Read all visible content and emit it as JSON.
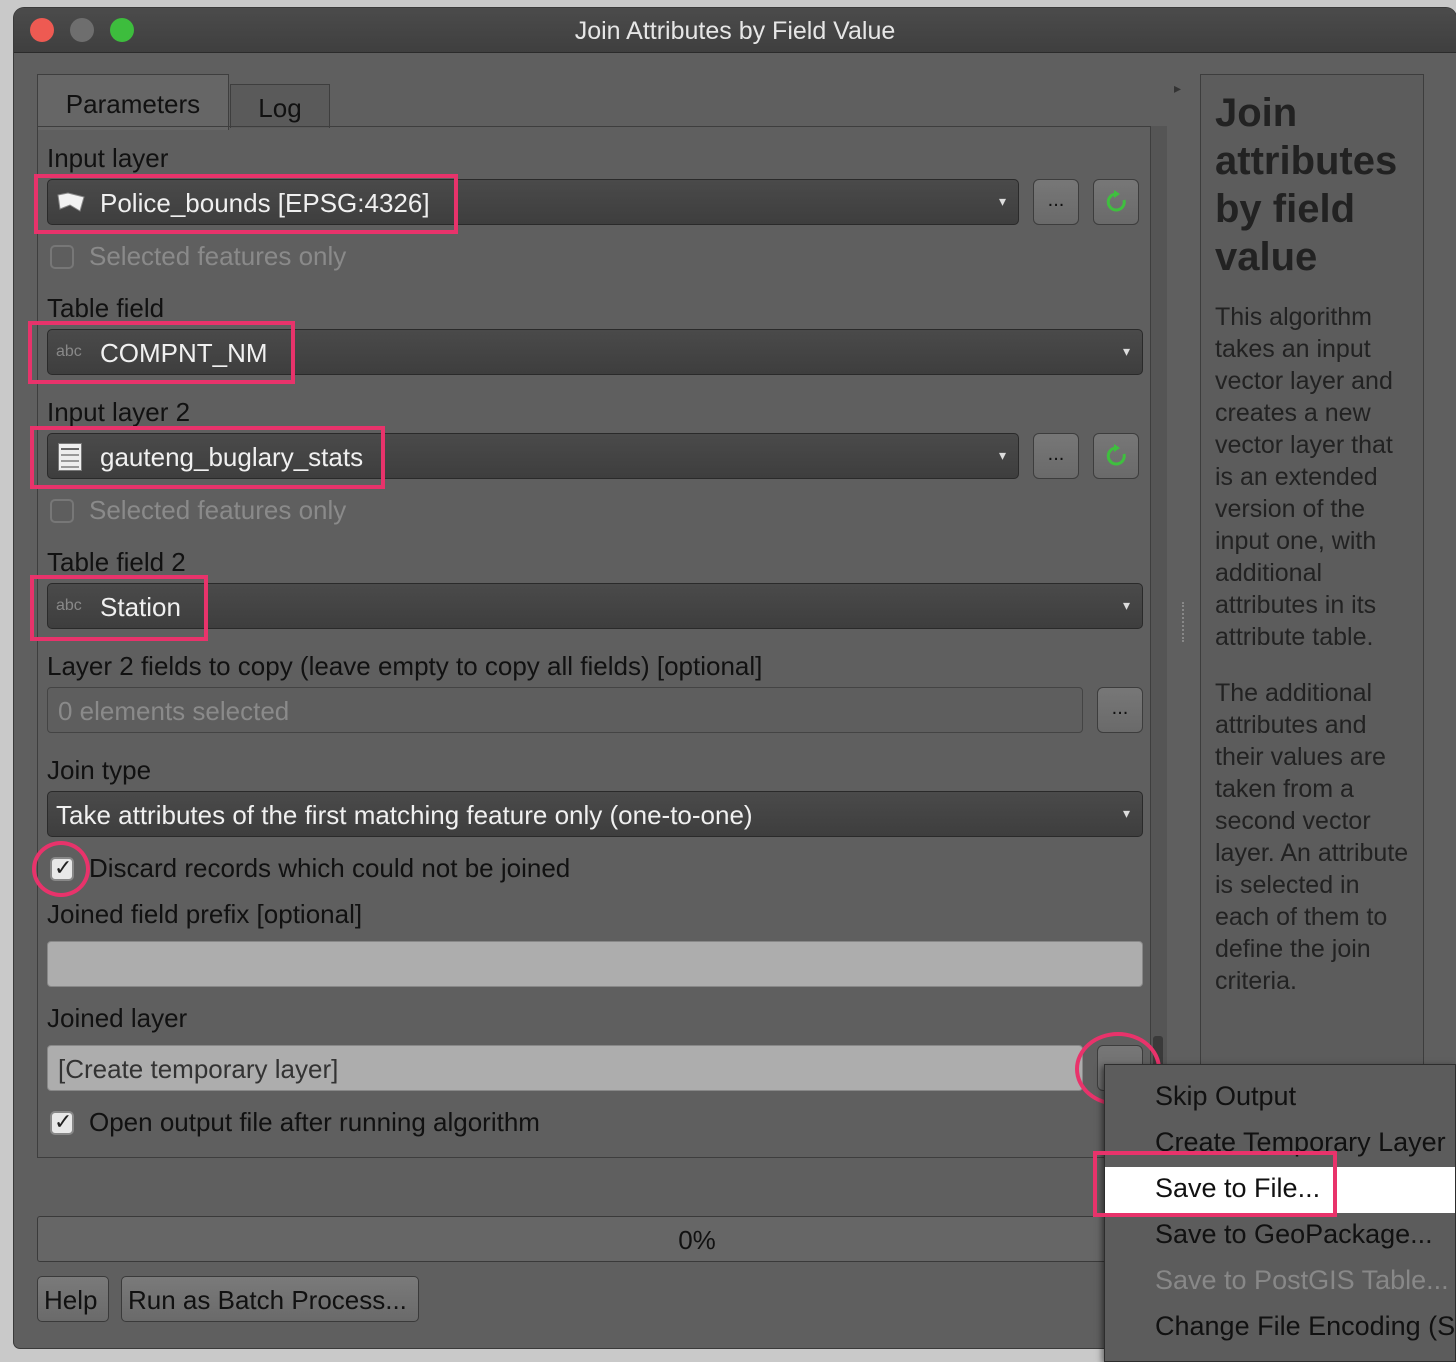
{
  "window": {
    "title": "Join Attributes by Field Value"
  },
  "tabs": [
    {
      "label": "Parameters"
    },
    {
      "label": "Log"
    }
  ],
  "params": {
    "input_layer_label": "Input layer",
    "input_layer_value": "Police_bounds [EPSG:4326]",
    "selected_only_1": "Selected features only",
    "table_field_label": "Table field",
    "table_field_value": "COMPNT_NM",
    "input_layer2_label": "Input layer 2",
    "input_layer2_value": "gauteng_buglary_stats",
    "selected_only_2": "Selected features only",
    "table_field2_label": "Table field 2",
    "table_field2_value": "Station",
    "fields_to_copy_label": "Layer 2 fields to copy (leave empty to copy all fields) [optional]",
    "fields_to_copy_value": "0 elements selected",
    "join_type_label": "Join type",
    "join_type_value": "Take attributes of the first matching feature only (one-to-one)",
    "discard_label": "Discard records which could not be joined",
    "prefix_label": "Joined field prefix [optional]",
    "prefix_value": "",
    "joined_layer_label": "Joined layer",
    "joined_layer_value": "[Create temporary layer]",
    "open_output_label": "Open output file after running algorithm",
    "abc_tag": "abc",
    "browse_label": "...",
    "dropdown_arrow": "▾"
  },
  "progress": {
    "text": "0%",
    "value": 0
  },
  "buttons": {
    "help": "Help",
    "batch": "Run as Batch Process..."
  },
  "help": {
    "title": "Join attributes by field value",
    "p1": "This algorithm takes an input vector layer and creates a new vector layer that is an extended version of the input one, with additional attributes in its attribute table.",
    "p2": "The additional attributes and their values are taken from a second vector layer. An attribute is selected in each of them to define the join criteria."
  },
  "menu": {
    "items": [
      {
        "label": "Skip Output"
      },
      {
        "label": "Create Temporary Layer"
      },
      {
        "label": "Save to File..."
      },
      {
        "label": "Save to GeoPackage..."
      },
      {
        "label": "Save to PostGIS Table..."
      },
      {
        "label": "Change File Encoding (System)"
      }
    ]
  },
  "colors": {
    "highlight": "#e8336b",
    "refresh_icon": "#3fbf3f"
  }
}
